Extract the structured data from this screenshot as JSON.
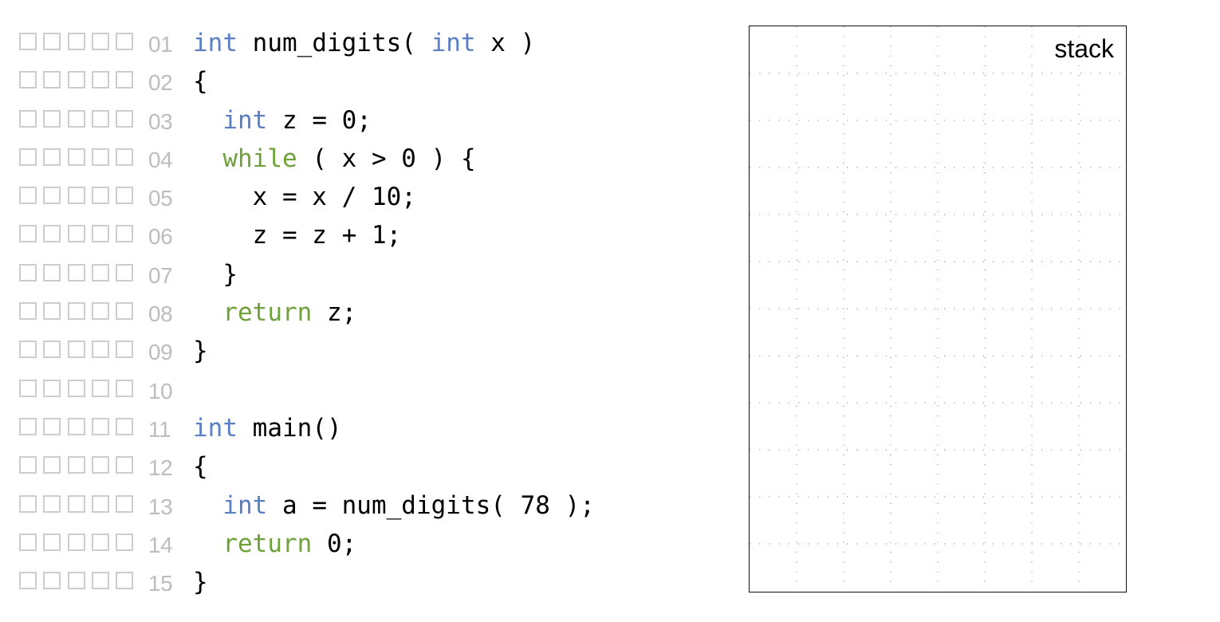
{
  "code": {
    "lines": [
      {
        "number": "01",
        "tokens": [
          {
            "text": "int",
            "kind": "type"
          },
          {
            "text": " num_digits( ",
            "kind": "plain"
          },
          {
            "text": "int",
            "kind": "type"
          },
          {
            "text": " x )",
            "kind": "plain"
          }
        ]
      },
      {
        "number": "02",
        "tokens": [
          {
            "text": "{",
            "kind": "plain"
          }
        ]
      },
      {
        "number": "03",
        "tokens": [
          {
            "text": "  ",
            "kind": "plain"
          },
          {
            "text": "int",
            "kind": "type"
          },
          {
            "text": " z = 0;",
            "kind": "plain"
          }
        ]
      },
      {
        "number": "04",
        "tokens": [
          {
            "text": "  ",
            "kind": "plain"
          },
          {
            "text": "while",
            "kind": "kw"
          },
          {
            "text": " ( x > 0 ) {",
            "kind": "plain"
          }
        ]
      },
      {
        "number": "05",
        "tokens": [
          {
            "text": "    x = x / 10;",
            "kind": "plain"
          }
        ]
      },
      {
        "number": "06",
        "tokens": [
          {
            "text": "    z = z + 1;",
            "kind": "plain"
          }
        ]
      },
      {
        "number": "07",
        "tokens": [
          {
            "text": "  }",
            "kind": "plain"
          }
        ]
      },
      {
        "number": "08",
        "tokens": [
          {
            "text": "  ",
            "kind": "plain"
          },
          {
            "text": "return",
            "kind": "kw"
          },
          {
            "text": " z;",
            "kind": "plain"
          }
        ]
      },
      {
        "number": "09",
        "tokens": [
          {
            "text": "}",
            "kind": "plain"
          }
        ]
      },
      {
        "number": "10",
        "tokens": []
      },
      {
        "number": "11",
        "tokens": [
          {
            "text": "int",
            "kind": "type"
          },
          {
            "text": " main()",
            "kind": "plain"
          }
        ]
      },
      {
        "number": "12",
        "tokens": [
          {
            "text": "{",
            "kind": "plain"
          }
        ]
      },
      {
        "number": "13",
        "tokens": [
          {
            "text": "  ",
            "kind": "plain"
          },
          {
            "text": "int",
            "kind": "type"
          },
          {
            "text": " a = num_digits( 78 );",
            "kind": "plain"
          }
        ]
      },
      {
        "number": "14",
        "tokens": [
          {
            "text": "  ",
            "kind": "plain"
          },
          {
            "text": "return",
            "kind": "kw"
          },
          {
            "text": " 0;",
            "kind": "plain"
          }
        ]
      },
      {
        "number": "15",
        "tokens": [
          {
            "text": "}",
            "kind": "plain"
          }
        ]
      }
    ],
    "checkboxes_per_line": 5,
    "colors": {
      "type": "#5a7fc4",
      "keyword": "#6fa23b",
      "line_number": "#bdbdbd",
      "checkbox_border": "#cdcdcd"
    }
  },
  "stack": {
    "label": "stack",
    "grid": "dotted"
  }
}
